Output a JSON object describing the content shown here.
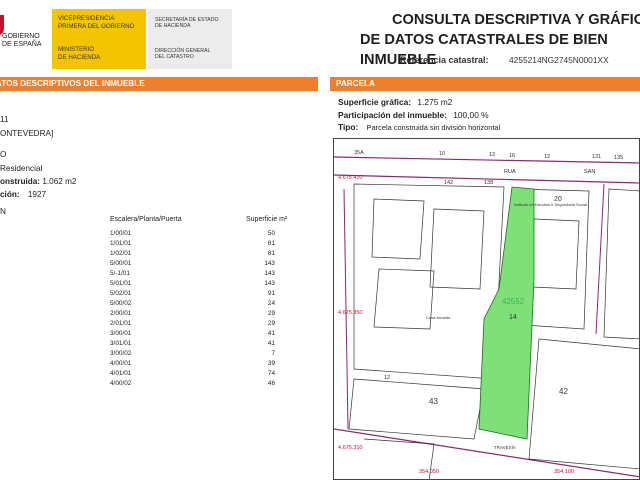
{
  "header": {
    "logo_left_lines": [
      "GOBIERNO",
      "DE ESPAÑA"
    ],
    "logo_yellow_top": [
      "VICEPRESIDENCIA",
      "PRIMERA DEL GOBIERNO"
    ],
    "logo_yellow_bottom": [
      "MINISTERIO",
      "DE HACIENDA"
    ],
    "logo_grey_top": [
      "SECRETARÍA DE ESTADO",
      "DE HACIENDA"
    ],
    "logo_grey_bottom": [
      "DIRECCIÓN GENERAL",
      "DEL CATASTRO"
    ],
    "title_line1": "CONSULTA DESCRIPTIVA Y GRÁFICA",
    "title_line2": "DE DATOS CATASTRALES DE BIEN INMUEBLE",
    "ref_label": "Referencia catastral:",
    "ref_value": "4255214NG2745N0001XX"
  },
  "left": {
    "section_title": "DATOS DESCRIPTIVOS DEL INMUEBLE",
    "lines": [
      {
        "text": "11"
      },
      {
        "text": "ONTEVEDRA]"
      },
      {
        "text": "O"
      },
      {
        "text": "Residencial"
      },
      {
        "label": "onstruida:",
        "value": "1.062 m2"
      },
      {
        "label": "ción:",
        "value": "1927"
      },
      {
        "text": "N"
      }
    ],
    "table": {
      "header_pl": "Escalera/Planta/Puerta",
      "header_sup": "Superficie m²",
      "rows": [
        {
          "pl": "1/00/01",
          "sup": "50"
        },
        {
          "pl": "1/01/01",
          "sup": "81"
        },
        {
          "pl": "1/02/01",
          "sup": "81"
        },
        {
          "pl": "5/00/01",
          "sup": "143"
        },
        {
          "pl": "5/-1/01",
          "sup": "143"
        },
        {
          "pl": "5/01/01",
          "sup": "143"
        },
        {
          "pl": "5/02/01",
          "sup": "91"
        },
        {
          "pl": "5/00/02",
          "sup": "24"
        },
        {
          "pl": "2/00/01",
          "sup": "29"
        },
        {
          "pl": "2/01/01",
          "sup": "29"
        },
        {
          "pl": "3/00/01",
          "sup": "41"
        },
        {
          "pl": "3/01/01",
          "sup": "41"
        },
        {
          "pl": "3/00/02",
          "sup": "7"
        },
        {
          "pl": "4/00/01",
          "sup": "39"
        },
        {
          "pl": "4/01/01",
          "sup": "74"
        },
        {
          "pl": "4/00/02",
          "sup": "46"
        }
      ]
    }
  },
  "right": {
    "section_title": "PARCELA",
    "sup_label": "Superficie gráfica:",
    "sup_value": "1.275 m2",
    "part_label": "Participación del inmueble:",
    "part_value": "100,00 %",
    "tipo_label": "Tipo:",
    "tipo_value": "Parcela construida sin división horizontal"
  },
  "map": {
    "labels": [
      "35A",
      "10",
      "13",
      "16",
      "12",
      "20",
      "131",
      "135",
      "138",
      "142",
      "RUA",
      "SAN",
      "4.675.410",
      "20",
      "14",
      "42",
      "43",
      "2",
      "4",
      "9",
      "12",
      "4.675.310",
      "4.675.350",
      "354.050",
      "354.100",
      "4255214",
      "Instituto de Estudios e Seguridade Social",
      "Casa Armada",
      "PRAZA",
      "TRAVESÍA"
    ],
    "parcel_label": "42552",
    "colors": {
      "parcel": "#7fe07a",
      "streets": "#8a2a6f",
      "lines": "#333333"
    }
  }
}
